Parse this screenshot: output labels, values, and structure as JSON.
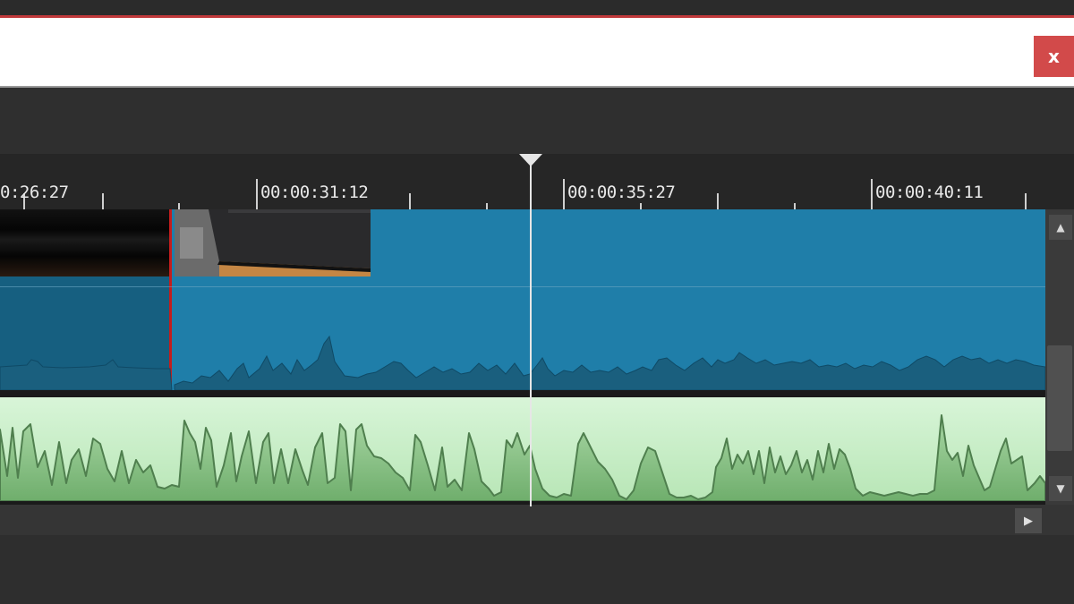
{
  "header": {
    "close_label": "x"
  },
  "timeline": {
    "ruler_labels": [
      "0:26:27",
      "00:00:31:12",
      "00:00:35:27",
      "00:00:40:11"
    ]
  },
  "scroll": {
    "up_glyph": "▲",
    "down_glyph": "▼",
    "right_glyph": "▶"
  },
  "colors": {
    "accent": "#c0393b",
    "video_track": "#1f7ea9",
    "selected_clip_border": "#c41d1d",
    "audio_track": "#c6ecc4",
    "playhead": "#e6e6e6"
  }
}
